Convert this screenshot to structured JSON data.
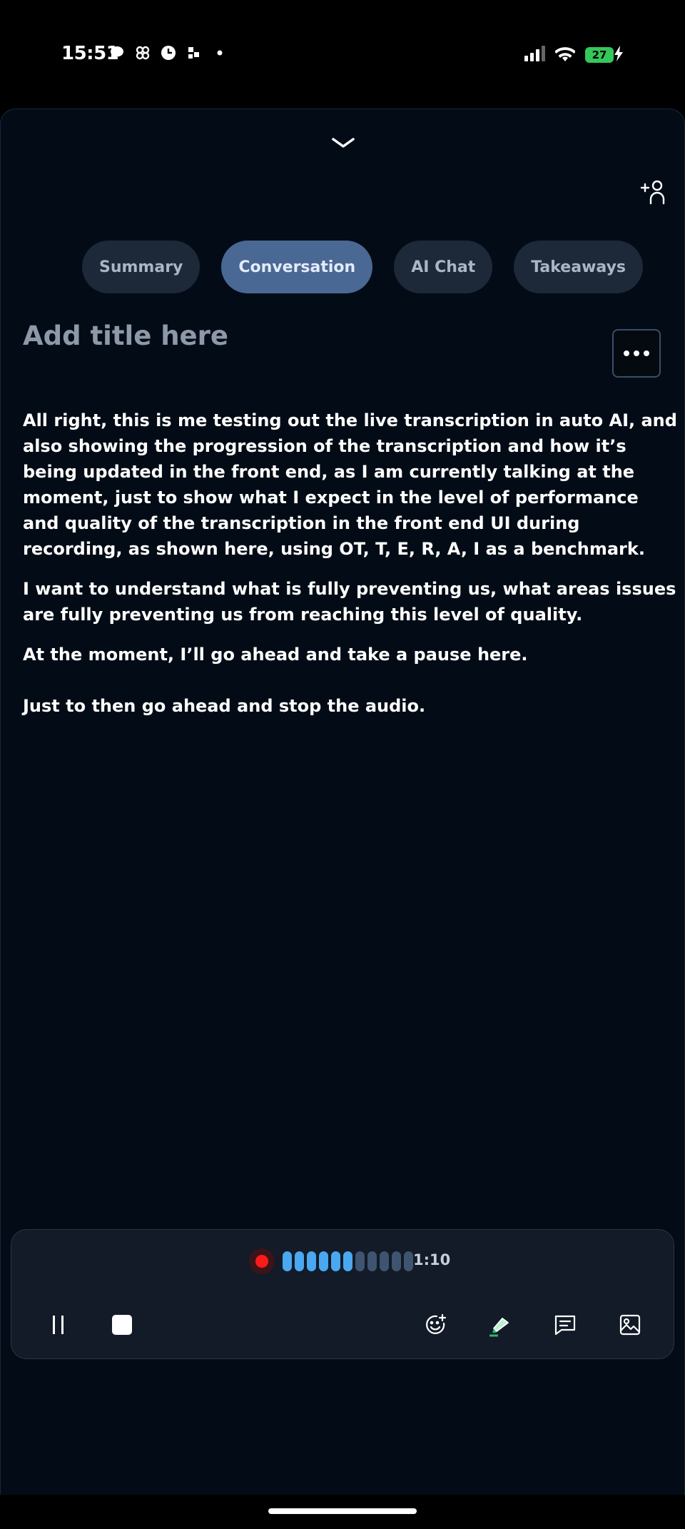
{
  "status_bar": {
    "time": "15:51",
    "battery": "27",
    "notification_icons": [
      "chat-bubble-icon",
      "pinwheel-icon",
      "clock-icon",
      "tiktok-icon",
      "dot-icon"
    ],
    "system_icons": [
      "signal-icon",
      "wifi-icon",
      "battery-icon",
      "charging-icon"
    ]
  },
  "tabs": [
    {
      "label": "Summary",
      "active": false
    },
    {
      "label": "Conversation",
      "active": true
    },
    {
      "label": "AI Chat",
      "active": false
    },
    {
      "label": "Takeaways",
      "active": false
    }
  ],
  "note": {
    "title_placeholder": "Add title here",
    "paragraphs": [
      "All right, this is me testing out the live transcription in auto AI, and also showing the progression of the transcription and how it’s being updated in the front end, as I am currently talking at the moment, just to show what I expect in the level of performance and quality of the transcription in the front end UI during recording, as shown here, using OT, T, E, R, A, I as a benchmark.",
      "I want to understand what is fully preventing us, what areas issues are fully preventing us from reaching this level of quality.",
      "At the moment, I’ll go ahead and take a pause here.",
      "Just to then go ahead and stop the audio."
    ]
  },
  "recorder": {
    "elapsed": "1:10",
    "waveform_active_bars": 6,
    "waveform_total_bars": 11,
    "active_color": "#4aa8f0",
    "inactive_color": "#3e5470",
    "record_color": "#ff1a1a",
    "controls": [
      "pause-icon",
      "stop-icon",
      "emoji-add-icon",
      "highlighter-icon",
      "comment-icon",
      "image-icon"
    ]
  },
  "colors": {
    "background": "#030c16",
    "tab_inactive": "#1d2939",
    "tab_active": "#4a6894",
    "battery": "#34c759"
  }
}
